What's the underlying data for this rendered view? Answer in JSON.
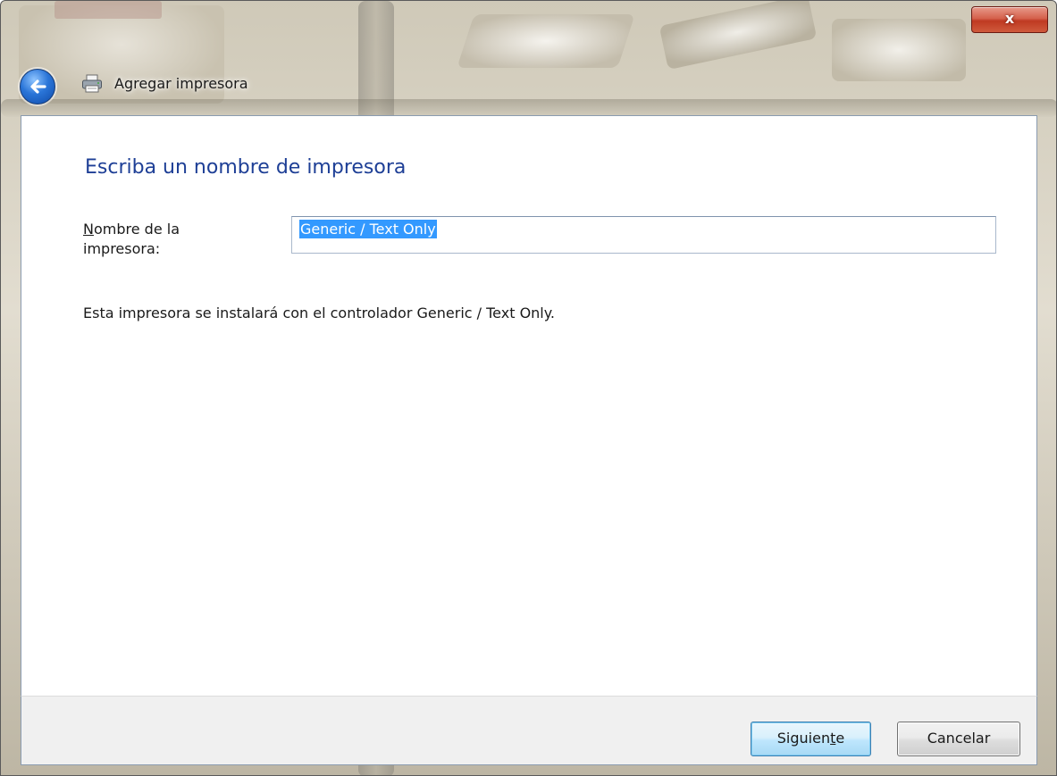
{
  "window": {
    "title": "Agregar impresora",
    "close_glyph": "x"
  },
  "icons": {
    "back": "back-arrow-icon",
    "printer": "printer-icon"
  },
  "main": {
    "heading": "Escriba un nombre de impresora",
    "name_label_accel": "N",
    "name_label_rest_line1": "ombre de la",
    "name_label_line2": "impresora:",
    "name_value": "Generic / Text Only",
    "info_text": "Esta impresora se instalará con el controlador Generic / Text Only."
  },
  "footer": {
    "next_pre": "Siguien",
    "next_accel": "t",
    "next_post": "e",
    "cancel_label": "Cancelar"
  },
  "colors": {
    "heading": "#1e3f96",
    "selection": "#3399ff",
    "close_button": "#c8452c"
  }
}
